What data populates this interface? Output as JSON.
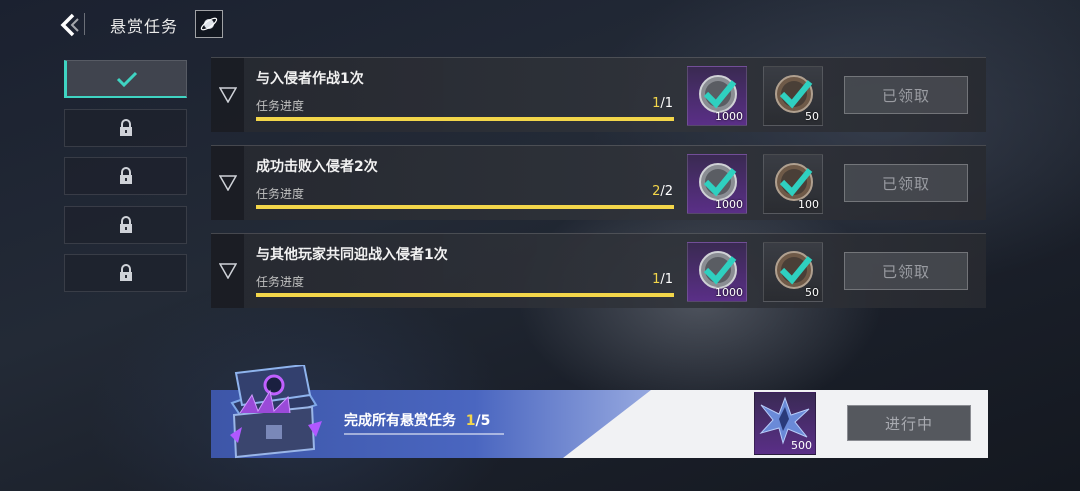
{
  "header": {
    "title": "悬赏任务"
  },
  "sidebar": {
    "tabs": [
      {
        "state": "completed"
      },
      {
        "state": "locked"
      },
      {
        "state": "locked"
      },
      {
        "state": "locked"
      },
      {
        "state": "locked"
      }
    ]
  },
  "tasks": [
    {
      "name": "与入侵者作战1次",
      "progress_label": "任务进度",
      "current": "1",
      "total": "/1",
      "progress": 1.0,
      "rewards": [
        {
          "qty": "1000",
          "rarity": "purple"
        },
        {
          "qty": "50",
          "rarity": "gray"
        }
      ],
      "button": "已领取"
    },
    {
      "name": "成功击败入侵者2次",
      "progress_label": "任务进度",
      "current": "2",
      "total": "/2",
      "progress": 1.0,
      "rewards": [
        {
          "qty": "1000",
          "rarity": "purple"
        },
        {
          "qty": "100",
          "rarity": "gray"
        }
      ],
      "button": "已领取"
    },
    {
      "name": "与其他玩家共同迎战入侵者1次",
      "progress_label": "任务进度",
      "current": "1",
      "total": "/1",
      "progress": 1.0,
      "rewards": [
        {
          "qty": "1000",
          "rarity": "purple"
        },
        {
          "qty": "50",
          "rarity": "gray"
        }
      ],
      "button": "已领取"
    }
  ],
  "banner": {
    "text": "完成所有悬赏任务",
    "current": "1",
    "total": "/5",
    "reward_qty": "500",
    "button": "进行中"
  },
  "colors": {
    "accent": "#3fd4c2",
    "progress": "#f3d64a",
    "banner": "#4a66c0"
  }
}
